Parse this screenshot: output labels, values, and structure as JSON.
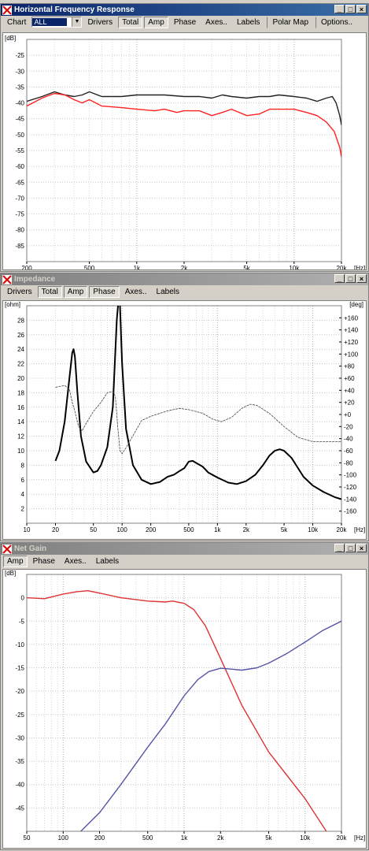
{
  "windows": {
    "freq": {
      "title": "Horizontal Frequency Response",
      "chart_label": "Chart",
      "chart_select": "ALL",
      "buttons": [
        "Drivers",
        "Total",
        "Amp",
        "Phase",
        "Axes..",
        "Labels",
        "Polar Map",
        "Options.."
      ]
    },
    "imp": {
      "title": "Impedance",
      "buttons": [
        "Drivers",
        "Total",
        "Amp",
        "Phase",
        "Axes..",
        "Labels"
      ]
    },
    "gain": {
      "title": "Net Gain",
      "buttons": [
        "Amp",
        "Phase",
        "Axes..",
        "Labels"
      ]
    }
  },
  "chart_data": [
    {
      "type": "line",
      "ylabel": "[dB]",
      "xlabel": "[Hz]",
      "x_scale": "log",
      "xlim": [
        200,
        20000
      ],
      "ylim": [
        -90,
        -20
      ],
      "y_ticks": [
        "-25",
        "-30",
        "-35",
        "-40",
        "-45",
        "-50",
        "-55",
        "-60",
        "-65",
        "-70",
        "-75",
        "-80",
        "-85"
      ],
      "x_ticks": [
        "200",
        "500",
        "1k",
        "2k",
        "5k",
        "10k",
        "20k"
      ],
      "grid": true,
      "series": [
        {
          "color": "#222222",
          "points": [
            [
              200,
              -39.5
            ],
            [
              250,
              -38
            ],
            [
              300,
              -36.5
            ],
            [
              350,
              -37.5
            ],
            [
              400,
              -38
            ],
            [
              450,
              -37.5
            ],
            [
              500,
              -36.5
            ],
            [
              600,
              -38
            ],
            [
              800,
              -38
            ],
            [
              1000,
              -37.5
            ],
            [
              1500,
              -37.5
            ],
            [
              2000,
              -38
            ],
            [
              2500,
              -38
            ],
            [
              3000,
              -38.5
            ],
            [
              3500,
              -37.5
            ],
            [
              4000,
              -38
            ],
            [
              5000,
              -38.5
            ],
            [
              6000,
              -38
            ],
            [
              7000,
              -38
            ],
            [
              8000,
              -37.5
            ],
            [
              10000,
              -38
            ],
            [
              12000,
              -38.5
            ],
            [
              14000,
              -39.5
            ],
            [
              16000,
              -38.5
            ],
            [
              17500,
              -38
            ],
            [
              18500,
              -40
            ],
            [
              19500,
              -44
            ],
            [
              20000,
              -47
            ]
          ]
        },
        {
          "color": "#ff2020",
          "points": [
            [
              200,
              -41
            ],
            [
              250,
              -38.5
            ],
            [
              300,
              -37
            ],
            [
              350,
              -37.5
            ],
            [
              400,
              -39
            ],
            [
              450,
              -40
            ],
            [
              500,
              -39
            ],
            [
              600,
              -41
            ],
            [
              800,
              -41.5
            ],
            [
              1000,
              -42
            ],
            [
              1300,
              -42.5
            ],
            [
              1500,
              -42
            ],
            [
              1800,
              -43
            ],
            [
              2000,
              -42.5
            ],
            [
              2500,
              -42.5
            ],
            [
              3000,
              -44
            ],
            [
              3500,
              -43
            ],
            [
              4000,
              -42
            ],
            [
              5000,
              -44
            ],
            [
              6000,
              -43.5
            ],
            [
              7000,
              -42
            ],
            [
              8000,
              -42
            ],
            [
              10000,
              -42
            ],
            [
              12000,
              -43
            ],
            [
              14000,
              -44
            ],
            [
              16000,
              -46
            ],
            [
              18000,
              -49
            ],
            [
              19500,
              -54
            ],
            [
              20000,
              -57
            ]
          ]
        }
      ]
    },
    {
      "type": "line",
      "ylabel": "[ohm]",
      "y2label": "[deg]",
      "xlabel": "[Hz]",
      "x_scale": "log",
      "xlim": [
        10,
        20000
      ],
      "ylim": [
        0,
        30
      ],
      "y2lim": [
        -180,
        180
      ],
      "y_ticks": [
        "2",
        "4",
        "6",
        "8",
        "10",
        "12",
        "14",
        "16",
        "18",
        "20",
        "22",
        "24",
        "26",
        "28"
      ],
      "y2_ticks": [
        "+160",
        "+140",
        "+120",
        "+100",
        "+80",
        "+60",
        "+40",
        "+20",
        "+0",
        "-20",
        "-40",
        "-60",
        "-80",
        "-100",
        "-120",
        "-140",
        "-160"
      ],
      "x_ticks": [
        "10",
        "20",
        "50",
        "100",
        "200",
        "500",
        "1k",
        "2k",
        "5k",
        "10k",
        "20k"
      ],
      "grid": true,
      "series": [
        {
          "color": "#000000",
          "style": "thick",
          "axis": "left",
          "points": [
            [
              20,
              8.6
            ],
            [
              22,
              10
            ],
            [
              25,
              14
            ],
            [
              28,
              20
            ],
            [
              30,
              23.5
            ],
            [
              31,
              24
            ],
            [
              32,
              23
            ],
            [
              34,
              18
            ],
            [
              37,
              12
            ],
            [
              42,
              8.5
            ],
            [
              50,
              7
            ],
            [
              55,
              7.2
            ],
            [
              60,
              8
            ],
            [
              70,
              10.5
            ],
            [
              80,
              16
            ],
            [
              88,
              28
            ],
            [
              92,
              31
            ],
            [
              95,
              30
            ],
            [
              100,
              22
            ],
            [
              110,
              13
            ],
            [
              130,
              8
            ],
            [
              160,
              6
            ],
            [
              200,
              5.4
            ],
            [
              250,
              5.7
            ],
            [
              300,
              6.4
            ],
            [
              350,
              6.7
            ],
            [
              400,
              7.2
            ],
            [
              450,
              7.6
            ],
            [
              500,
              8.5
            ],
            [
              550,
              8.6
            ],
            [
              600,
              8.3
            ],
            [
              700,
              7.8
            ],
            [
              800,
              7
            ],
            [
              1000,
              6.3
            ],
            [
              1300,
              5.6
            ],
            [
              1600,
              5.4
            ],
            [
              2000,
              5.8
            ],
            [
              2500,
              6.7
            ],
            [
              3000,
              8
            ],
            [
              3500,
              9.3
            ],
            [
              4000,
              10
            ],
            [
              4500,
              10.2
            ],
            [
              5000,
              10
            ],
            [
              6000,
              9
            ],
            [
              7000,
              7.6
            ],
            [
              8000,
              6.4
            ],
            [
              10000,
              5.2
            ],
            [
              13000,
              4.3
            ],
            [
              17000,
              3.6
            ],
            [
              20000,
              3.3
            ]
          ]
        },
        {
          "color": "#444444",
          "style": "thin-dashed",
          "axis": "right",
          "points": [
            [
              20,
              45
            ],
            [
              25,
              48
            ],
            [
              28,
              42
            ],
            [
              30,
              20
            ],
            [
              32,
              5
            ],
            [
              35,
              -20
            ],
            [
              38,
              -27
            ],
            [
              42,
              -15
            ],
            [
              50,
              5
            ],
            [
              60,
              20
            ],
            [
              70,
              36
            ],
            [
              80,
              38
            ],
            [
              85,
              30
            ],
            [
              90,
              -20
            ],
            [
              95,
              -60
            ],
            [
              100,
              -65
            ],
            [
              110,
              -55
            ],
            [
              130,
              -35
            ],
            [
              160,
              -10
            ],
            [
              200,
              -3
            ],
            [
              300,
              6
            ],
            [
              400,
              10
            ],
            [
              500,
              8
            ],
            [
              700,
              2
            ],
            [
              900,
              -8
            ],
            [
              1100,
              -12
            ],
            [
              1400,
              -5
            ],
            [
              1800,
              10
            ],
            [
              2200,
              17
            ],
            [
              2600,
              15
            ],
            [
              3500,
              2
            ],
            [
              5000,
              -20
            ],
            [
              7000,
              -38
            ],
            [
              10000,
              -45
            ],
            [
              20000,
              -45
            ]
          ]
        }
      ]
    },
    {
      "type": "line",
      "ylabel": "[dB]",
      "xlabel": "[Hz]",
      "x_scale": "log",
      "xlim": [
        50,
        20000
      ],
      "ylim": [
        -50,
        5
      ],
      "y_ticks": [
        "0",
        "-5",
        "-10",
        "-15",
        "-20",
        "-25",
        "-30",
        "-35",
        "-40",
        "-45"
      ],
      "x_ticks": [
        "50",
        "100",
        "200",
        "500",
        "1k",
        "2k",
        "5k",
        "10k",
        "20k"
      ],
      "grid": true,
      "series": [
        {
          "color": "#dd3333",
          "points": [
            [
              50,
              0
            ],
            [
              70,
              -0.2
            ],
            [
              100,
              0.8
            ],
            [
              130,
              1.3
            ],
            [
              160,
              1.5
            ],
            [
              200,
              1
            ],
            [
              300,
              0
            ],
            [
              500,
              -0.7
            ],
            [
              700,
              -0.9
            ],
            [
              800,
              -0.7
            ],
            [
              1000,
              -1.2
            ],
            [
              1200,
              -2.5
            ],
            [
              1500,
              -6
            ],
            [
              2000,
              -13
            ],
            [
              3000,
              -23
            ],
            [
              5000,
              -33
            ],
            [
              10000,
              -43
            ],
            [
              15000,
              -50
            ]
          ]
        },
        {
          "color": "#5555aa",
          "points": [
            [
              140,
              -50
            ],
            [
              200,
              -46
            ],
            [
              300,
              -40
            ],
            [
              500,
              -32
            ],
            [
              700,
              -27
            ],
            [
              1000,
              -21
            ],
            [
              1300,
              -17.5
            ],
            [
              1600,
              -15.8
            ],
            [
              2000,
              -15.1
            ],
            [
              2500,
              -15.3
            ],
            [
              3000,
              -15.5
            ],
            [
              4000,
              -15
            ],
            [
              5000,
              -14
            ],
            [
              7000,
              -12
            ],
            [
              10000,
              -9.5
            ],
            [
              14000,
              -7
            ],
            [
              20000,
              -5
            ]
          ]
        }
      ]
    }
  ]
}
